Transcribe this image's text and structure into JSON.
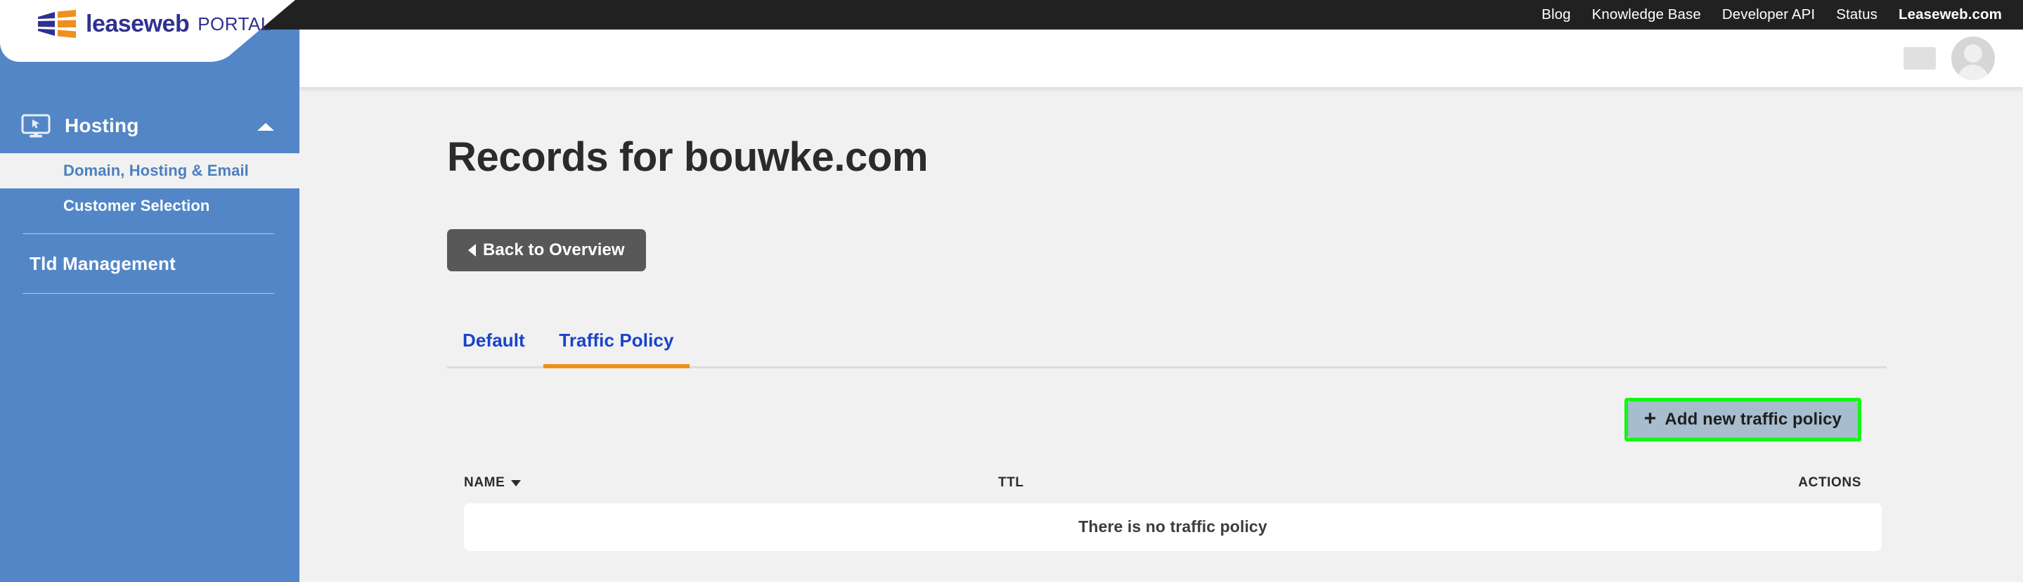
{
  "brand": {
    "logo_word": "leaseweb",
    "logo_suffix": "PORTAL",
    "colors": {
      "logo_blue": "#2e3192",
      "logo_orange": "#ef8f1f",
      "sidebar_blue": "#5386c6",
      "topbar_black": "#212121",
      "tab_blue": "#1a43c8",
      "tab_active_underline": "#ef8f1f",
      "highlight_green": "#12f712",
      "back_button_gray": "#585858",
      "add_button_bg": "#a7bccd"
    }
  },
  "topnav": {
    "items": [
      {
        "label": "Blog",
        "bold": false
      },
      {
        "label": "Knowledge Base",
        "bold": false
      },
      {
        "label": "Developer API",
        "bold": false
      },
      {
        "label": "Status",
        "bold": false
      },
      {
        "label": "Leaseweb.com",
        "bold": true
      }
    ]
  },
  "header": {
    "avatar_alt": "user-avatar"
  },
  "sidebar": {
    "group": {
      "label": "Hosting",
      "icon": "monitor-cursor-icon",
      "chevron": "chevron-up-icon",
      "expanded": true,
      "sub_items": [
        {
          "label": "Domain, Hosting & Email",
          "active": true
        },
        {
          "label": "Customer Selection",
          "active": false
        }
      ]
    },
    "items": [
      {
        "label": "Tld Management"
      }
    ]
  },
  "main": {
    "page_title": "Records for bouwke.com",
    "back_button": "Back to Overview",
    "tabs": [
      {
        "label": "Default",
        "active": false
      },
      {
        "label": "Traffic Policy",
        "active": true
      }
    ],
    "add_button": "Add new traffic policy",
    "table": {
      "columns": [
        {
          "label": "NAME",
          "sorted": true
        },
        {
          "label": "TTL",
          "sorted": false
        },
        {
          "label": "ACTIONS",
          "sorted": false
        }
      ],
      "empty_message": "There is no traffic policy",
      "rows": []
    }
  }
}
